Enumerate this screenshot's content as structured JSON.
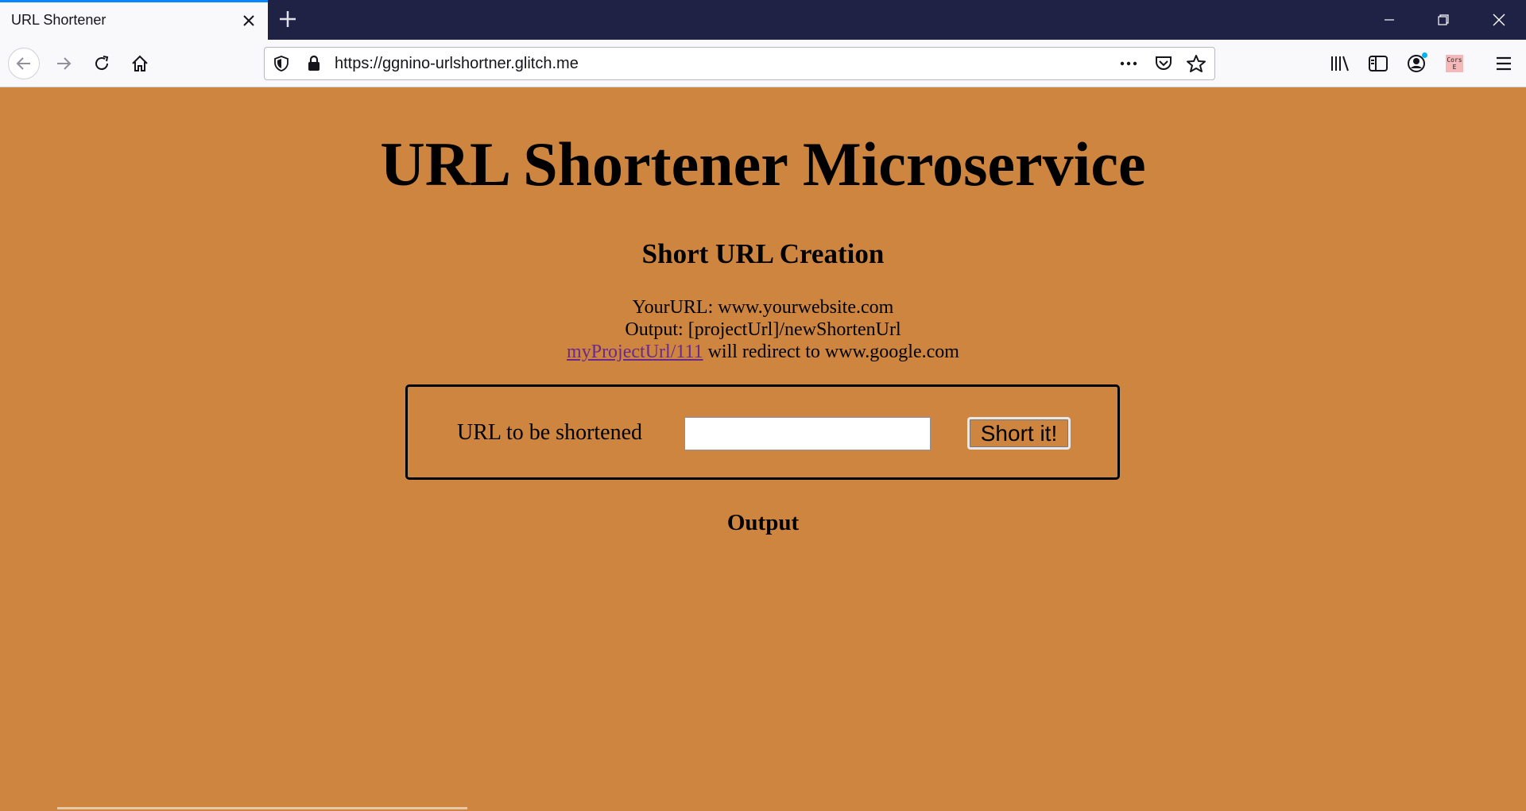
{
  "browser": {
    "tab": {
      "title": "URL Shortener"
    },
    "address_bar": {
      "url": "https://ggnino-urlshortner.glitch.me"
    },
    "extension_badge": {
      "line1": "Cors",
      "line2": "E"
    },
    "accent_color": "#0a84ff",
    "titlebar_color": "#1f2244"
  },
  "page": {
    "background_color": "#cd853f",
    "title": "URL Shortener Microservice",
    "subtitle": "Short URL Creation",
    "description": {
      "line1": "YourURL: www.yourwebsite.com",
      "line2": "Output: [projectUrl]/newShortenUrl",
      "link_text": "myProjectUrl/111",
      "line3_rest": " will redirect to www.google.com"
    },
    "form": {
      "label": "URL to be shortened",
      "input_value": "",
      "submit_label": "Short it!"
    },
    "output_heading": "Output"
  },
  "icons": {
    "tab_close": "close-icon",
    "new_tab": "plus-icon",
    "back": "arrow-left-icon",
    "forward": "arrow-right-icon",
    "reload": "reload-icon",
    "home": "home-icon",
    "tracking": "shield-icon",
    "lock": "lock-icon",
    "page_actions": "more-icon",
    "pocket": "pocket-icon",
    "bookmark": "star-icon",
    "library": "library-icon",
    "sidebar": "sidebar-icon",
    "account": "account-icon",
    "menu": "hamburger-icon"
  }
}
